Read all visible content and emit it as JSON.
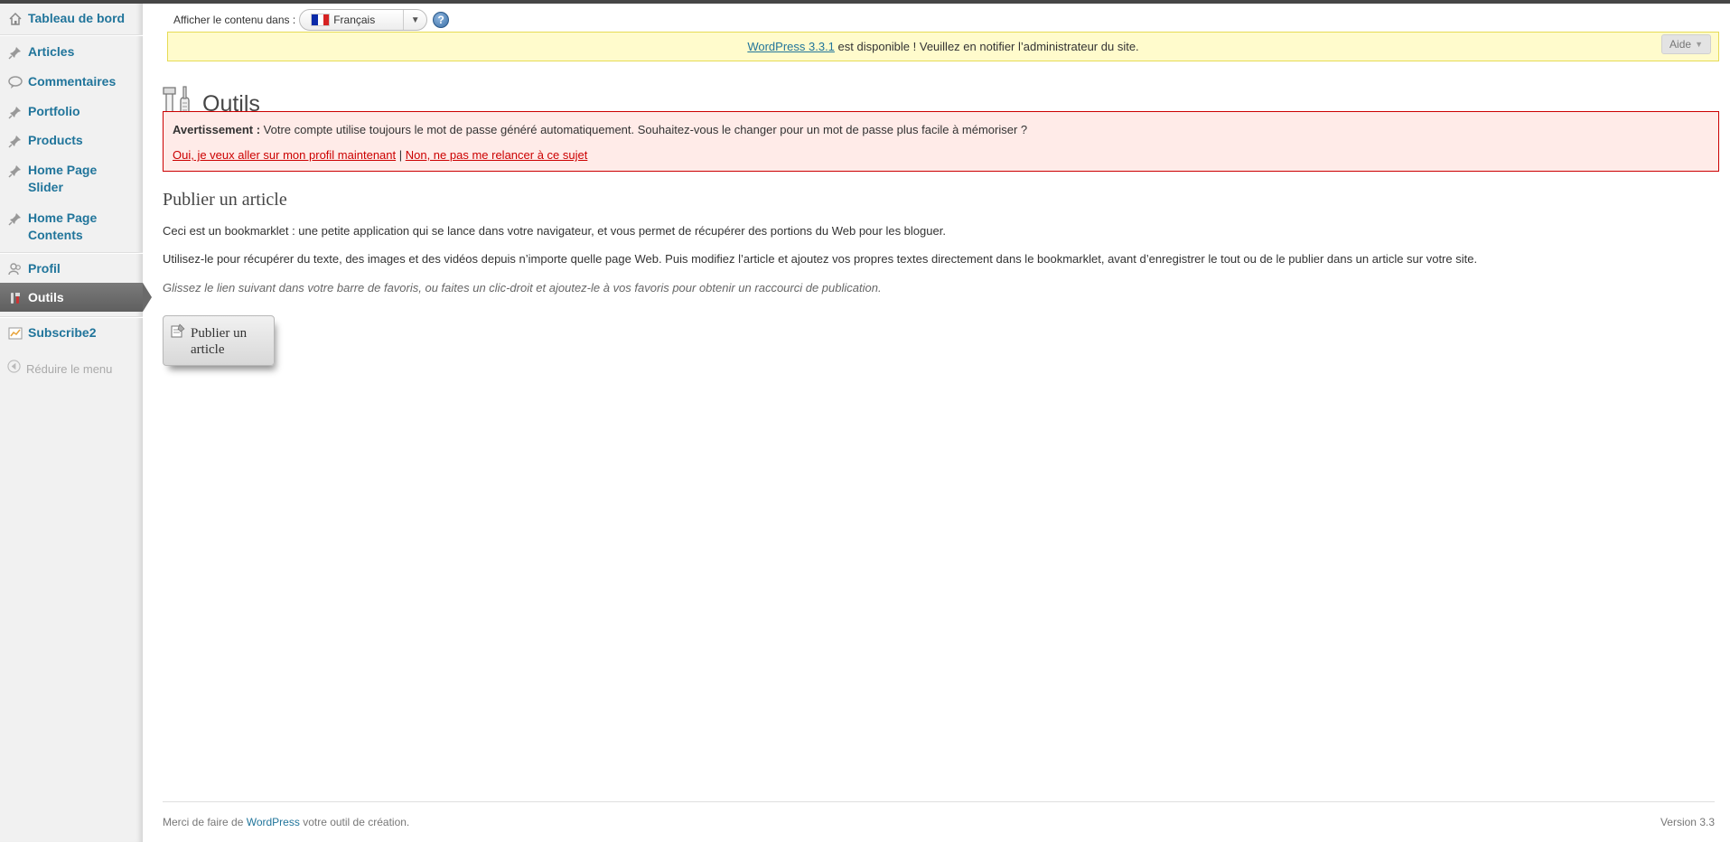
{
  "sidebar": {
    "items": [
      {
        "label": "Tableau de bord",
        "icon": "home-icon"
      },
      {
        "label": "Articles",
        "icon": "pin-icon"
      },
      {
        "label": "Commentaires",
        "icon": "comment-icon"
      },
      {
        "label": "Portfolio",
        "icon": "pin-icon"
      },
      {
        "label": "Products",
        "icon": "pin-icon"
      },
      {
        "label": "Home Page\nSlider",
        "icon": "pin-icon"
      },
      {
        "label": "Home Page\nContents",
        "icon": "pin-icon"
      },
      {
        "label": "Profil",
        "icon": "users-icon"
      },
      {
        "label": "Outils",
        "icon": "tools-icon"
      },
      {
        "label": "Subscribe2",
        "icon": "chart-icon"
      }
    ],
    "collapse_label": "Réduire le menu"
  },
  "screen_meta": {
    "display_label": "Afficher le contenu dans :",
    "language": "Français",
    "help_glyph": "?"
  },
  "update_nag": {
    "link": "WordPress 3.3.1",
    "text": " est disponible ! Veuillez en notifier l’administrateur du site.",
    "help_button": "Aide"
  },
  "page": {
    "title": "Outils"
  },
  "warning": {
    "label": "Avertissement :",
    "message": " Votre compte utilise toujours le mot de passe généré automatiquement. Souhaitez-vous le changer pour un mot de passe plus facile à mémoriser ?",
    "link_yes": "Oui, je veux aller sur mon profil maintenant",
    "separator": " | ",
    "link_no": "Non, ne pas me relancer à ce sujet"
  },
  "press_this": {
    "heading": "Publier un article",
    "para1": "Ceci est un bookmarklet : une petite application qui se lance dans votre navigateur, et vous permet de récupérer des portions du Web pour les bloguer.",
    "para2": "Utilisez-le pour récupérer du texte, des images et des vidéos depuis n’importe quelle page Web. Puis modifiez l’article et ajoutez vos propres textes directement dans le bookmarklet, avant d’enregistrer le tout ou de le publier dans un article sur votre site.",
    "para3": "Glissez le lien suivant dans votre barre de favoris, ou faites un clic-droit et ajoutez-le à vos favoris pour obtenir un raccourci de publication.",
    "button_label": "Publier un article"
  },
  "footer": {
    "thanks_prefix": "Merci de faire de ",
    "thanks_link": "WordPress",
    "thanks_suffix": " votre outil de création.",
    "version": "Version 3.3"
  },
  "colors": {
    "link": "#21759b",
    "nag_bg": "#fffbcc",
    "error_bg": "#ffebe8",
    "error_border": "#cc0000",
    "current_menu": "#6a6a6a"
  }
}
